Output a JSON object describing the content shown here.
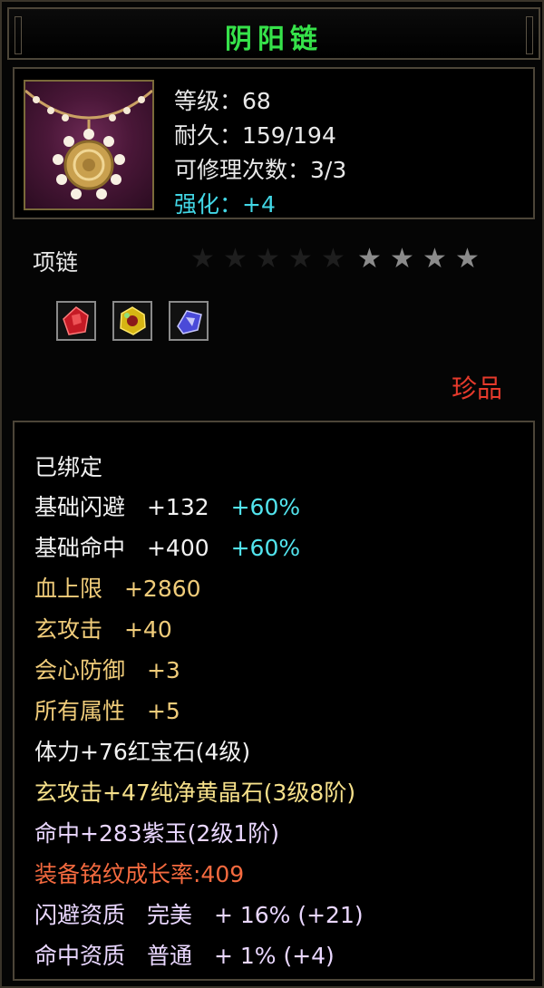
{
  "item": {
    "name": "阴阳链",
    "level": "等级：68",
    "durability": "耐久：159/194",
    "repair": "可修理次数：3/3",
    "enhance": "强化：+4",
    "type": "项链",
    "rarity": "珍品",
    "stars": {
      "filled": 5,
      "total": 9
    },
    "gems": [
      "ruby-gem-icon",
      "yellow-crystal-gem-icon",
      "purple-jade-gem-icon"
    ]
  },
  "stats": {
    "bound": "已绑定",
    "dodge": {
      "label": "基础闪避",
      "value": "+132",
      "bonus": "+60%"
    },
    "hit": {
      "label": "基础命中",
      "value": "+400",
      "bonus": "+60%"
    },
    "hp": {
      "label": "血上限",
      "value": "+2860"
    },
    "xuan": {
      "label": "玄攻击",
      "value": "+40"
    },
    "crit_def": {
      "label": "会心防御",
      "value": "+3"
    },
    "all_attr": {
      "label": "所有属性",
      "value": "+5"
    },
    "gem1": "体力+76红宝石(4级)",
    "gem2": "玄攻击+47纯净黄晶石(3级8阶)",
    "gem3": "命中+283紫玉(2级1阶)",
    "growth": "装备铭纹成长率:409",
    "q1": {
      "label": "闪避资质",
      "grade": "完美",
      "value": "+ 16% (+21)"
    },
    "q2": {
      "label": "命中资质",
      "grade": "普通",
      "value": "+ 1% (+4)"
    }
  },
  "colors": {
    "title": "#36e24a",
    "enhance": "#42d7e6",
    "rarity": "#e63a2c",
    "gold_stat": "#f0cc7a",
    "growth": "#f56a3f"
  }
}
